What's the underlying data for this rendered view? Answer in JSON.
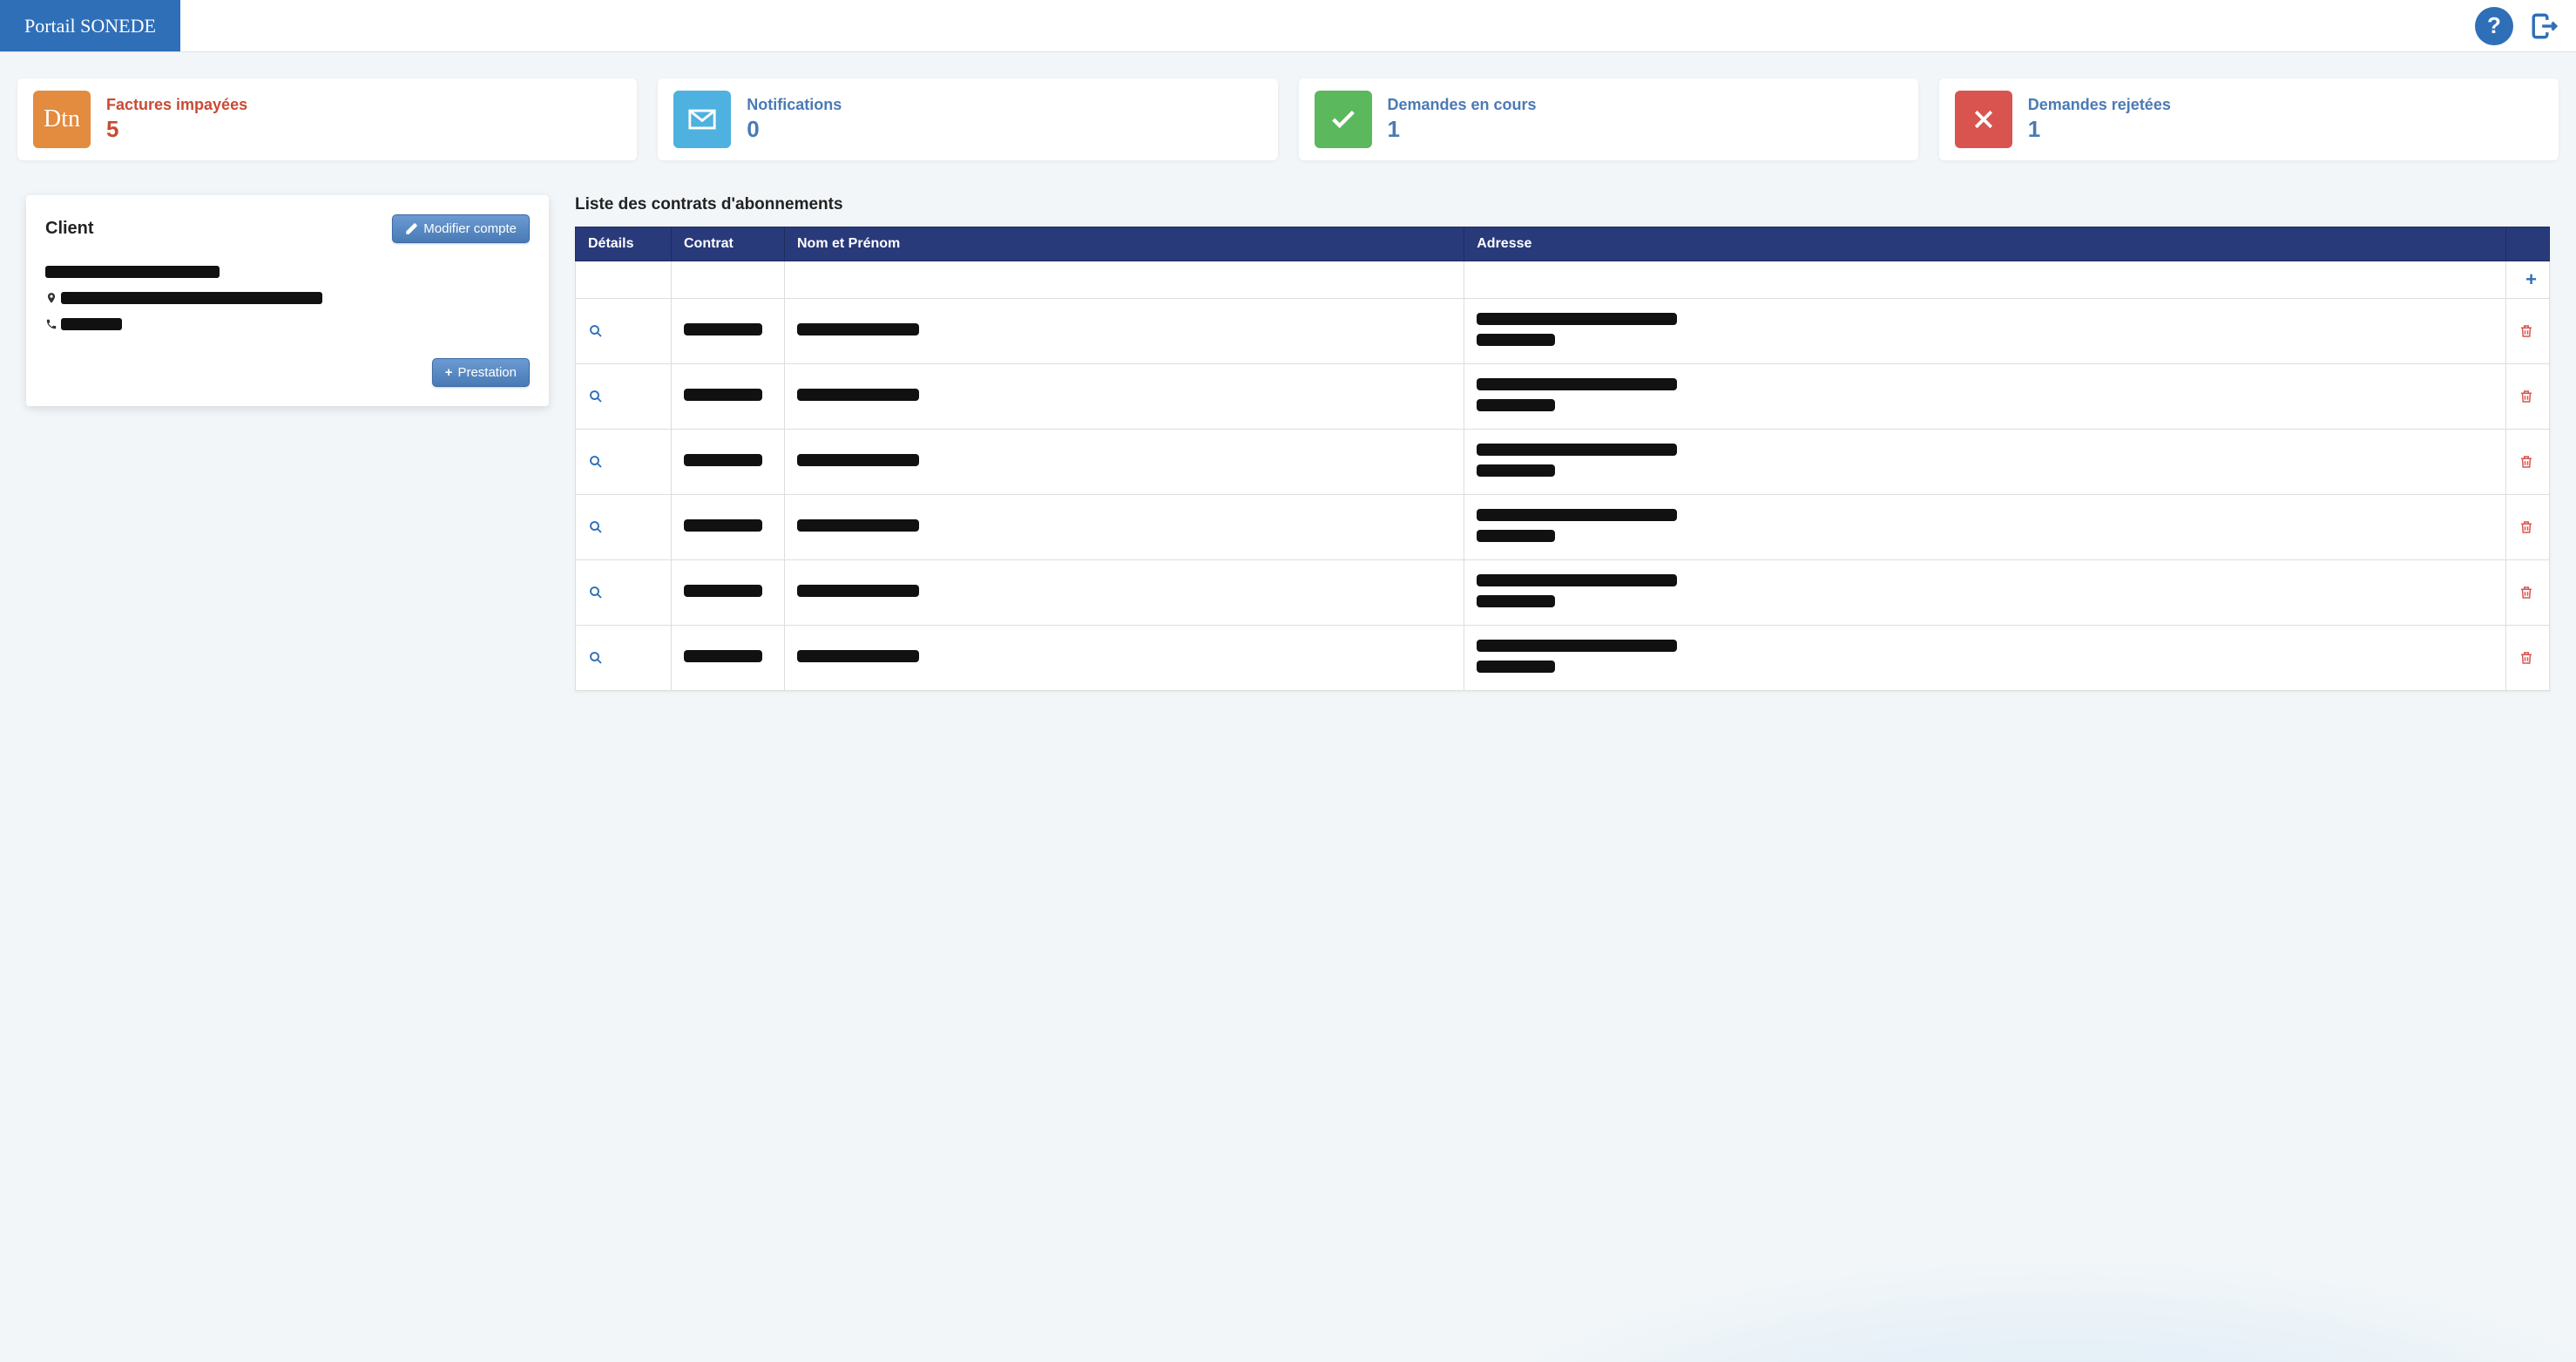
{
  "header": {
    "brand": "Portail SONEDE"
  },
  "stats": {
    "unpaid": {
      "label": "Factures impayées",
      "value": "5",
      "icon_text": "Dtn"
    },
    "notif": {
      "label": "Notifications",
      "value": "0"
    },
    "pending": {
      "label": "Demandes en cours",
      "value": "1"
    },
    "rejected": {
      "label": "Demandes rejetées",
      "value": "1"
    }
  },
  "client": {
    "title": "Client",
    "modify_btn": "Modifier compte",
    "prestation_btn": "Prestation"
  },
  "contracts": {
    "title": "Liste des contrats d'abonnements",
    "columns": {
      "details": "Détails",
      "contrat": "Contrat",
      "name": "Nom et Prénom",
      "address": "Adresse",
      "actions": ""
    },
    "rows": [
      {
        "contrat": "[redacted]",
        "name": "[redacted]",
        "address": "[redacted]"
      },
      {
        "contrat": "[redacted]",
        "name": "[redacted]",
        "address": "[redacted]"
      },
      {
        "contrat": "[redacted]",
        "name": "[redacted]",
        "address": "[redacted]"
      },
      {
        "contrat": "[redacted]",
        "name": "[redacted]",
        "address": "[redacted]"
      },
      {
        "contrat": "[redacted]",
        "name": "[redacted]",
        "address": "[redacted]"
      },
      {
        "contrat": "[redacted]",
        "name": "[redacted]",
        "address": "[redacted]"
      }
    ]
  }
}
